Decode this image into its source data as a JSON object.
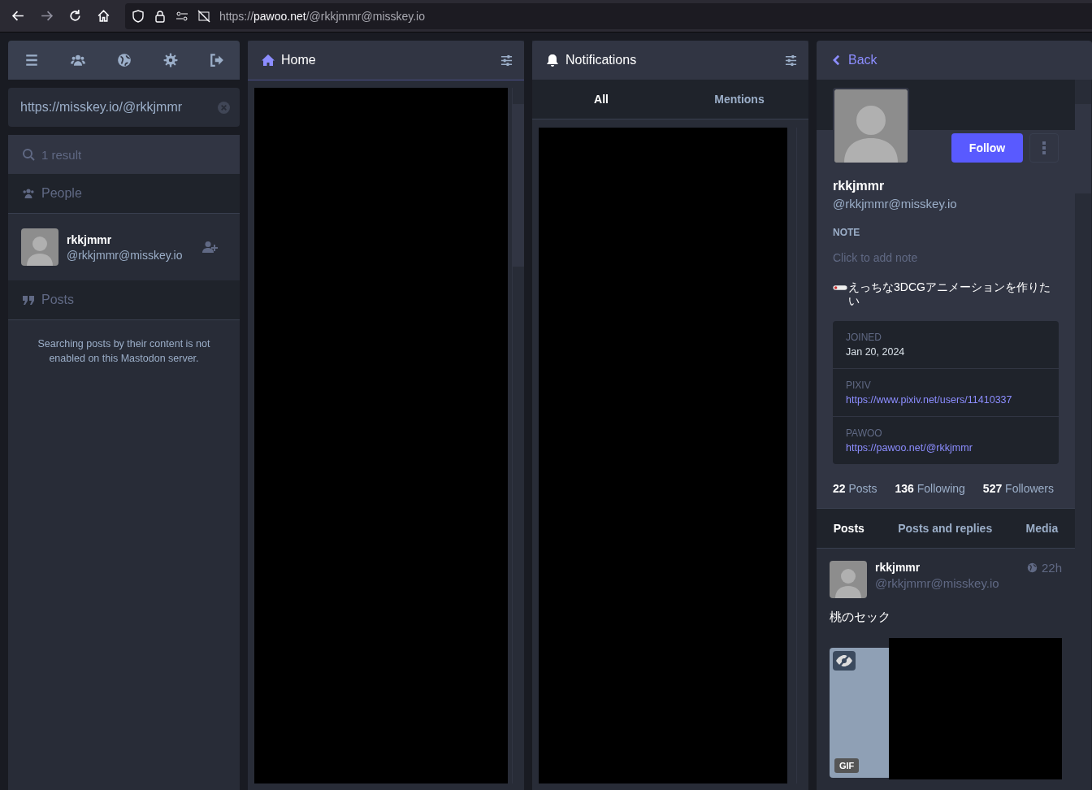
{
  "browser": {
    "url_scheme": "https://",
    "url_host": "pawoo.net",
    "url_path": "/@rkkjmmr@misskey.io"
  },
  "search": {
    "value": "https://misskey.io/@rkkjmmr",
    "results_count": "1 result",
    "people_heading": "People",
    "people": [
      {
        "name": "rkkjmmr",
        "handle": "@rkkjmmr@misskey.io"
      }
    ],
    "posts_heading": "Posts",
    "posts_message": "Searching posts by their content is not enabled on this Mastodon server."
  },
  "home_column": {
    "title": "Home"
  },
  "notifications_column": {
    "title": "Notifications",
    "tabs": [
      {
        "label": "All",
        "selected": true
      },
      {
        "label": "Mentions",
        "selected": false
      }
    ]
  },
  "profile": {
    "back": "Back",
    "follow_button": "Follow",
    "display_name": "rkkjmmr",
    "handle": "@rkkjmmr@misskey.io",
    "note_label": "NOTE",
    "note_placeholder": "Click to add note",
    "bio": "えっちな3DCGアニメーションを作りたい",
    "fields": [
      {
        "label": "JOINED",
        "value": "Jan 20, 2024",
        "kind": "text"
      },
      {
        "label": "PIXIV",
        "value": "https://www.pixiv.net/users/11410337",
        "kind": "link"
      },
      {
        "label": "PAWOO",
        "value": "https://pawoo.net/@rkkjmmr",
        "kind": "link"
      }
    ],
    "stats": [
      {
        "count": "22",
        "label": "Posts"
      },
      {
        "count": "136",
        "label": "Following"
      },
      {
        "count": "527",
        "label": "Followers"
      }
    ],
    "tabs": [
      {
        "label": "Posts",
        "selected": true
      },
      {
        "label": "Posts and replies",
        "selected": false
      },
      {
        "label": "Media",
        "selected": false
      }
    ],
    "posts": [
      {
        "name": "rkkjmmr",
        "handle": "@rkkjmmr@misskey.io",
        "time": "22h",
        "text": "桃のセック",
        "media_badge": "GIF"
      }
    ]
  }
}
